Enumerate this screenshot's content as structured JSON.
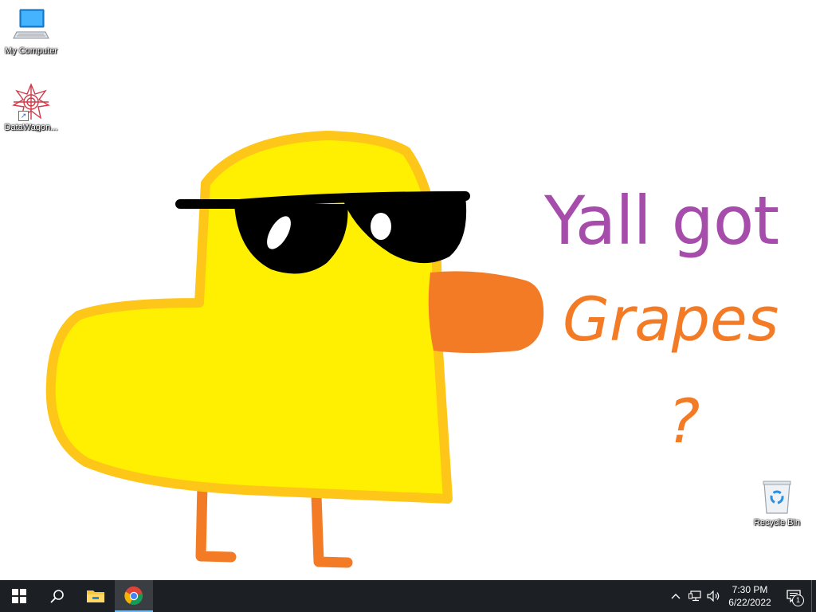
{
  "wallpaper": {
    "line1": "Yall got",
    "line2": "Grapes",
    "line3": "?",
    "colors": {
      "line1": "#a64dab",
      "line2": "#f47b26",
      "duck_body": "#fef000",
      "duck_outline": "#ffc61a",
      "beak": "#f47b26",
      "legs": "#f47b26",
      "sunglasses": "#000000"
    }
  },
  "desktop_icons": [
    {
      "label": "My Computer",
      "icon": "computer-icon"
    },
    {
      "label": "DataWagon...",
      "icon": "datawagon-icon"
    },
    {
      "label": "Recycle Bin",
      "icon": "recycle-bin-icon"
    }
  ],
  "taskbar": {
    "start_icon": "windows-logo-icon",
    "search_icon": "search-icon",
    "pinned": [
      {
        "name": "File Explorer",
        "icon": "folder-icon",
        "active": false
      },
      {
        "name": "Google Chrome",
        "icon": "chrome-icon",
        "active": true
      }
    ],
    "tray": {
      "time": "7:30 PM",
      "date": "6/22/2022",
      "notification_count": "1",
      "icons": [
        "chevron-up-icon",
        "network-icon",
        "volume-icon"
      ]
    },
    "colors": {
      "background": "#1c1f24",
      "active_underline": "#76b9ed"
    }
  }
}
